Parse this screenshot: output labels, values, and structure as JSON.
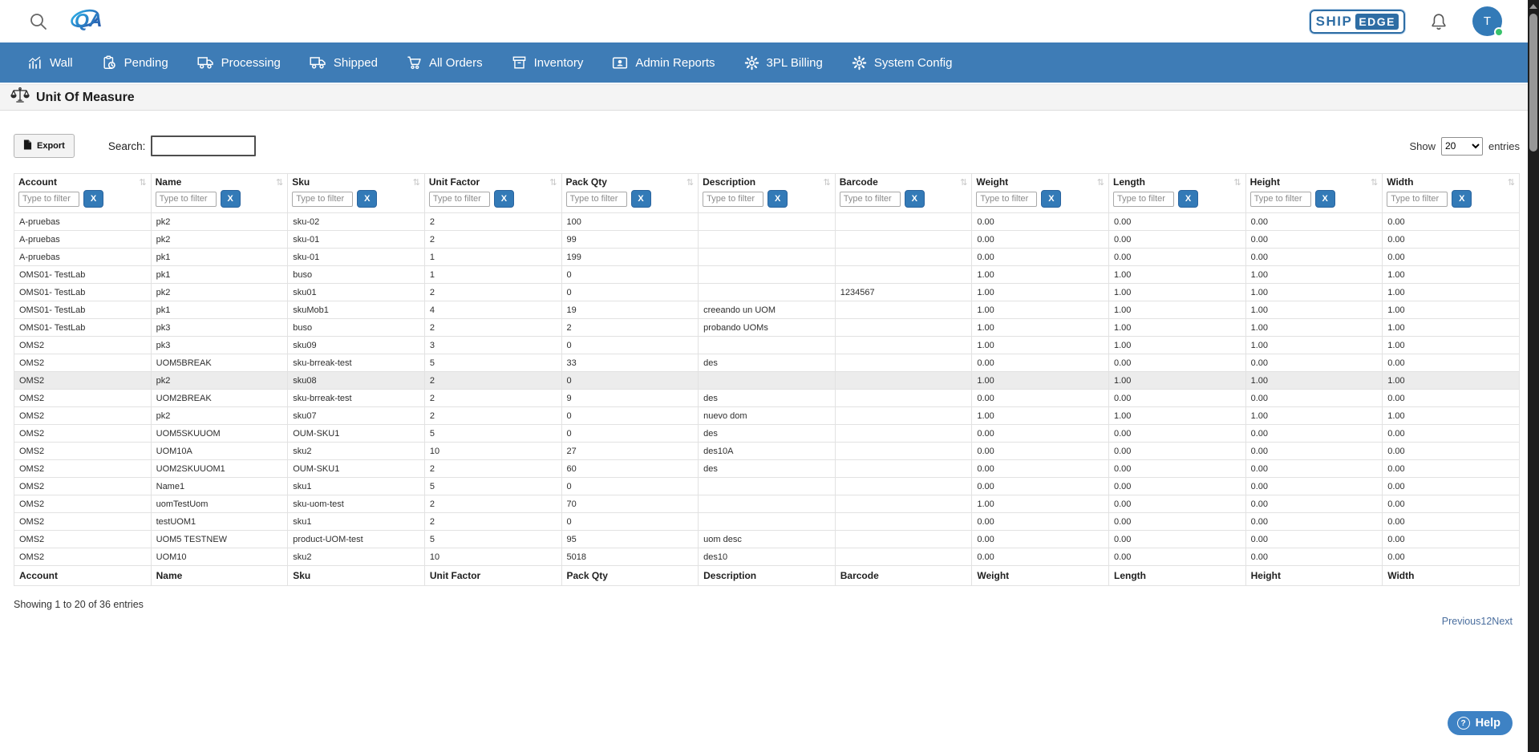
{
  "topbar": {
    "qa_logo_text": "QA",
    "brand_ship": "SHIP",
    "brand_edge": "EDGE",
    "avatar_initial": "T"
  },
  "nav": {
    "items": [
      {
        "label": "Wall",
        "icon": "chart-icon"
      },
      {
        "label": "Pending",
        "icon": "clipboard-clock-icon"
      },
      {
        "label": "Processing",
        "icon": "truck-icon"
      },
      {
        "label": "Shipped",
        "icon": "truck-icon"
      },
      {
        "label": "All Orders",
        "icon": "cart-icon"
      },
      {
        "label": "Inventory",
        "icon": "archive-box-icon"
      },
      {
        "label": "Admin Reports",
        "icon": "report-card-icon"
      },
      {
        "label": "3PL Billing",
        "icon": "gear-icon"
      },
      {
        "label": "System Config",
        "icon": "gear-icon"
      }
    ]
  },
  "page": {
    "title": "Unit Of Measure"
  },
  "toolbar": {
    "export_label": "Export",
    "search_label": "Search:",
    "search_value": "",
    "show_label": "Show",
    "entries_label": "entries",
    "page_size": "20"
  },
  "table": {
    "filter_placeholder": "Type to filter",
    "clear_button_label": "X",
    "sort_glyph": "⇅",
    "columns": [
      "Account",
      "Name",
      "Sku",
      "Unit Factor",
      "Pack Qty",
      "Description",
      "Barcode",
      "Weight",
      "Length",
      "Height",
      "Width"
    ],
    "highlighted_row_index": 9,
    "rows": [
      [
        "A-pruebas",
        "pk2",
        "sku-02",
        "2",
        "100",
        "",
        "",
        "0.00",
        "0.00",
        "0.00",
        "0.00"
      ],
      [
        "A-pruebas",
        "pk2",
        "sku-01",
        "2",
        "99",
        "",
        "",
        "0.00",
        "0.00",
        "0.00",
        "0.00"
      ],
      [
        "A-pruebas",
        "pk1",
        "sku-01",
        "1",
        "199",
        "",
        "",
        "0.00",
        "0.00",
        "0.00",
        "0.00"
      ],
      [
        "OMS01- TestLab",
        "pk1",
        "buso",
        "1",
        "0",
        "",
        "",
        "1.00",
        "1.00",
        "1.00",
        "1.00"
      ],
      [
        "OMS01- TestLab",
        "pk2",
        "sku01",
        "2",
        "0",
        "",
        "1234567",
        "1.00",
        "1.00",
        "1.00",
        "1.00"
      ],
      [
        "OMS01- TestLab",
        "pk1",
        "skuMob1",
        "4",
        "19",
        "creeando un UOM",
        "",
        "1.00",
        "1.00",
        "1.00",
        "1.00"
      ],
      [
        "OMS01- TestLab",
        "pk3",
        "buso",
        "2",
        "2",
        "probando UOMs",
        "",
        "1.00",
        "1.00",
        "1.00",
        "1.00"
      ],
      [
        "OMS2",
        "pk3",
        "sku09",
        "3",
        "0",
        "",
        "",
        "1.00",
        "1.00",
        "1.00",
        "1.00"
      ],
      [
        "OMS2",
        "UOM5BREAK",
        "sku-brreak-test",
        "5",
        "33",
        "des",
        "",
        "0.00",
        "0.00",
        "0.00",
        "0.00"
      ],
      [
        "OMS2",
        "pk2",
        "sku08",
        "2",
        "0",
        "",
        "",
        "1.00",
        "1.00",
        "1.00",
        "1.00"
      ],
      [
        "OMS2",
        "UOM2BREAK",
        "sku-brreak-test",
        "2",
        "9",
        "des",
        "",
        "0.00",
        "0.00",
        "0.00",
        "0.00"
      ],
      [
        "OMS2",
        "pk2",
        "sku07",
        "2",
        "0",
        "nuevo dom",
        "",
        "1.00",
        "1.00",
        "1.00",
        "1.00"
      ],
      [
        "OMS2",
        "UOM5SKUUOM",
        "OUM-SKU1",
        "5",
        "0",
        "des",
        "",
        "0.00",
        "0.00",
        "0.00",
        "0.00"
      ],
      [
        "OMS2",
        "UOM10A",
        "sku2",
        "10",
        "27",
        "des10A",
        "",
        "0.00",
        "0.00",
        "0.00",
        "0.00"
      ],
      [
        "OMS2",
        "UOM2SKUUOM1",
        "OUM-SKU1",
        "2",
        "60",
        "des",
        "",
        "0.00",
        "0.00",
        "0.00",
        "0.00"
      ],
      [
        "OMS2",
        "Name1",
        "sku1",
        "5",
        "0",
        "",
        "",
        "0.00",
        "0.00",
        "0.00",
        "0.00"
      ],
      [
        "OMS2",
        "uomTestUom",
        "sku-uom-test",
        "2",
        "70",
        "",
        "",
        "1.00",
        "0.00",
        "0.00",
        "0.00"
      ],
      [
        "OMS2",
        "testUOM1",
        "sku1",
        "2",
        "0",
        "",
        "",
        "0.00",
        "0.00",
        "0.00",
        "0.00"
      ],
      [
        "OMS2",
        "UOM5 TESTNEW",
        "product-UOM-test",
        "5",
        "95",
        "uom desc",
        "",
        "0.00",
        "0.00",
        "0.00",
        "0.00"
      ],
      [
        "OMS2",
        "UOM10",
        "sku2",
        "10",
        "5018",
        "des10",
        "",
        "0.00",
        "0.00",
        "0.00",
        "0.00"
      ]
    ]
  },
  "pager": {
    "summary": "Showing 1 to 20 of 36 entries",
    "links": [
      "Previous",
      "1",
      "2",
      "Next"
    ]
  },
  "help": {
    "label": "Help"
  },
  "colors": {
    "nav_blue": "#3e7cb6",
    "button_blue": "#337ab7",
    "link_blue": "#4a6e9e",
    "highlight_row": "#ececec"
  }
}
